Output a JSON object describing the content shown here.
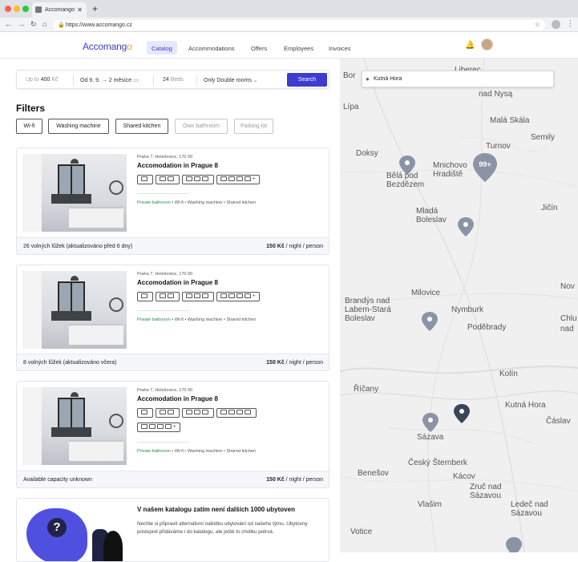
{
  "browser": {
    "tab_title": "Accomango",
    "url": "https://www.accomango.cz"
  },
  "app": {
    "logo_text": "Accomang",
    "logo_accent": "o",
    "nav": [
      "Catalog",
      "Accommodations",
      "Offers",
      "Employees",
      "Invoices"
    ],
    "active_nav": "Catalog",
    "colors": {
      "accent": "#3c3cd0",
      "amenity_green": "#2d8a4c"
    }
  },
  "search": {
    "price_prefix": "Up to",
    "price_value": "400",
    "price_unit": "Kč",
    "dates": "Od 9. 9. → 2 měsíce",
    "beds_value": "24",
    "beds_label": "Beds",
    "room_filter": "Only Double rooms",
    "button": "Search"
  },
  "filters": {
    "title": "Filters",
    "chips": [
      {
        "label": "Wi-fi",
        "active": true
      },
      {
        "label": "Washing machine",
        "active": true
      },
      {
        "label": "Shared kitchen",
        "active": true
      },
      {
        "label": "Own bathroom",
        "active": false
      },
      {
        "label": "Parking lot",
        "active": false
      }
    ]
  },
  "listings": [
    {
      "address": "Praha 7, Holešovice, 170 00",
      "title": "Accomodation in Prague 8",
      "amenities_green": "Private bathroom",
      "amenities_rest": " • Wi-fi • Washing machine • Shared kitchen",
      "availability": "26 volných lůžek (aktualizováno před 6 dny)",
      "price": "150 Kč",
      "price_unit": " / night / person"
    },
    {
      "address": "Praha 7, Holešovice, 170 00",
      "title": "Accomodation in Prague 8",
      "amenities_green": "Private bathroom",
      "amenities_rest": " • Wi-fi • Washing machine • Shared kitchen",
      "availability": "8 volných lůžek (aktualizováno včera)",
      "price": "150 Kč",
      "price_unit": " / night / person"
    },
    {
      "address": "Praha 7, Holešovice, 170 00",
      "title": "Accomodation in Prague 8",
      "amenities_green": "Private bathroom",
      "amenities_rest": " • Wi-fi • Washing machine • Shared kitchen",
      "availability": "Available capacity unknown",
      "price": "150 Kč",
      "price_unit": " / night / person"
    }
  ],
  "promo": {
    "title": "V našem katalogu zatím není dalších 1000 ubytoven",
    "text": "Nechte si připravit alternativní nabídku ubytování od našeho týmu. Ubytovny postupně přidáváme i do katalogu, ale ještě to chvilku potrvá.",
    "icon_label": "?"
  },
  "map": {
    "search_value": "Kutná Hora",
    "cluster_label": "99+",
    "places": [
      "Liberec",
      "Bor",
      "Lípa",
      "nad Nysą",
      "Malá Skála",
      "Semily",
      "Doksy",
      "Turnov",
      "Bělá pod Bezdězem",
      "Mnichovo Hradiště",
      "Mladá Boleslav",
      "Jičín",
      "Milovice",
      "Nymburk",
      "Brandýs nad Labem-Stará Boleslav",
      "Poděbrady",
      "Kolín",
      "Říčany",
      "Kutná Hora",
      "Sázava",
      "Čáslav",
      "Český Šternberk",
      "Benešov",
      "Kácov",
      "Zruč nad Sázavou",
      "Vlašim",
      "Ledeč nad Sázavou",
      "Votice",
      "Nov",
      "Chlu",
      "nad"
    ]
  }
}
